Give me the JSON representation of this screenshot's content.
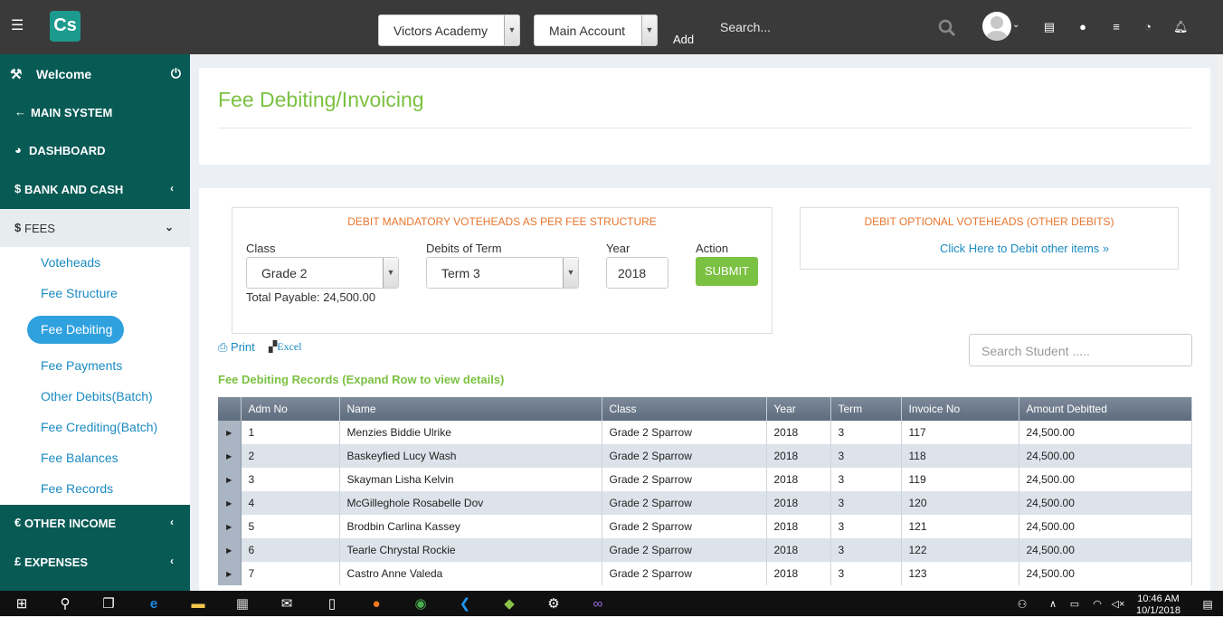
{
  "topbar": {
    "school_select": "Victors Academy",
    "account_select": "Main Account",
    "add_label": "Add",
    "search_placeholder": "Search..."
  },
  "sidebar": {
    "welcome": "Welcome",
    "items": [
      {
        "label": "MAIN SYSTEM",
        "icon": "arrow-left-icon"
      },
      {
        "label": "DASHBOARD",
        "icon": "dashboard-icon"
      },
      {
        "label": "BANK AND CASH",
        "icon": "dollar-icon"
      },
      {
        "label": "FEES",
        "icon": "dollar-icon"
      },
      {
        "label": "OTHER INCOME",
        "icon": "euro-icon"
      },
      {
        "label": "EXPENSES",
        "icon": "pound-icon"
      }
    ],
    "fees_sub": [
      "Voteheads",
      "Fee Structure",
      "Fee Debiting",
      "Fee Payments",
      "Other Debits(Batch)",
      "Fee Crediting(Batch)",
      "Fee Balances",
      "Fee Records"
    ]
  },
  "page": {
    "title": "Fee Debiting/Invoicing"
  },
  "mandatory": {
    "heading": "DEBIT MANDATORY VOTEHEADS AS PER FEE STRUCTURE",
    "class_label": "Class",
    "class_value": "Grade 2",
    "term_label": "Debits of Term",
    "term_value": "Term 3",
    "year_label": "Year",
    "year_value": "2018",
    "action_label": "Action",
    "submit": "SUBMIT",
    "total_payable": "Total Payable: 24,500.00"
  },
  "optional": {
    "heading": "DEBIT OPTIONAL VOTEHEADS (OTHER DEBITS)",
    "link": "Click Here to Debit other items"
  },
  "tools": {
    "print": "Print",
    "excel": "Excel",
    "search_placeholder": "Search Student ....."
  },
  "records": {
    "title": "Fee Debiting Records (Expand Row to view details)",
    "columns": [
      "Adm No",
      "Name",
      "Class",
      "Year",
      "Term",
      "Invoice No",
      "Amount Debitted"
    ],
    "rows": [
      [
        "1",
        "Menzies Biddie Ulrike",
        "Grade 2 Sparrow",
        "2018",
        "3",
        "117",
        "24,500.00"
      ],
      [
        "2",
        "Baskeyfied Lucy Wash",
        "Grade 2 Sparrow",
        "2018",
        "3",
        "118",
        "24,500.00"
      ],
      [
        "3",
        "Skayman Lisha Kelvin",
        "Grade 2 Sparrow",
        "2018",
        "3",
        "119",
        "24,500.00"
      ],
      [
        "4",
        "McGilleghole Rosabelle Dov",
        "Grade 2 Sparrow",
        "2018",
        "3",
        "120",
        "24,500.00"
      ],
      [
        "5",
        "Brodbin Carlina Kassey",
        "Grade 2 Sparrow",
        "2018",
        "3",
        "121",
        "24,500.00"
      ],
      [
        "6",
        "Tearle Chrystal Rockie",
        "Grade 2 Sparrow",
        "2018",
        "3",
        "122",
        "24,500.00"
      ],
      [
        "7",
        "Castro Anne Valeda",
        "Grade 2 Sparrow",
        "2018",
        "3",
        "123",
        "24,500.00"
      ]
    ]
  },
  "taskbar": {
    "time": "10:46 AM",
    "date": "10/1/2018"
  },
  "colors": {
    "sidebar": "#085a55",
    "accent_green": "#7bc142",
    "link_blue": "#1a8ac0",
    "orange": "#e8752e"
  }
}
